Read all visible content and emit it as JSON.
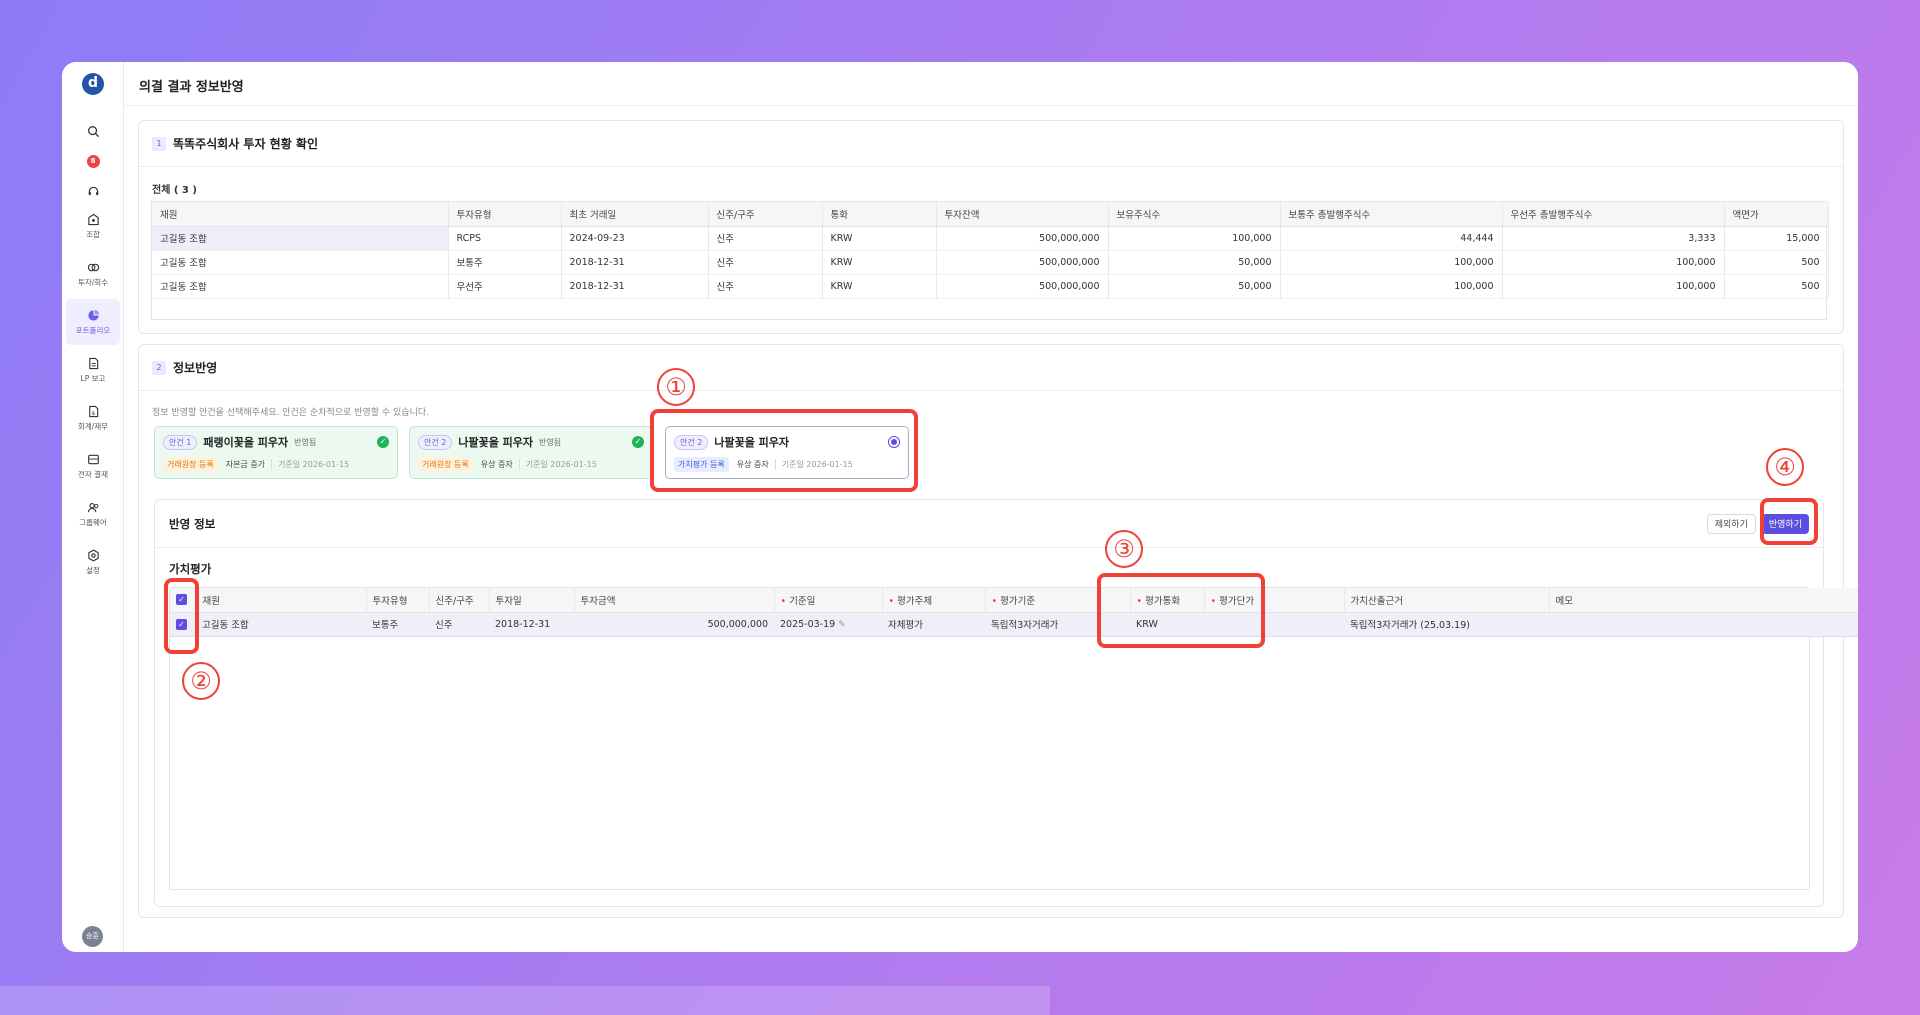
{
  "app": {
    "logo_letter": "d",
    "user_avatar": "승훈"
  },
  "page_title": "의결 결과 정보반영",
  "sidebar": {
    "top_icons": [
      {
        "name": "search-icon"
      },
      {
        "name": "notification-badge",
        "count": "8"
      },
      {
        "name": "headset-icon"
      }
    ],
    "items": [
      {
        "label": "조합",
        "icon": "association-icon",
        "active": false
      },
      {
        "label": "투자/회수",
        "icon": "investment-icon",
        "active": false
      },
      {
        "label": "포트폴리오",
        "icon": "portfolio-icon",
        "active": true
      },
      {
        "label": "LP 보고",
        "icon": "report-icon",
        "active": false
      },
      {
        "label": "회계/재무",
        "icon": "accounting-icon",
        "active": false
      },
      {
        "label": "전자 결재",
        "icon": "approval-icon",
        "active": false
      },
      {
        "label": "그룹웨어",
        "icon": "groupware-icon",
        "active": false
      },
      {
        "label": "설정",
        "icon": "settings-icon",
        "active": false
      }
    ]
  },
  "section1": {
    "number": "1",
    "title": "똑똑주식회사 투자 현황 확인",
    "count_label": "전체 ( 3 )",
    "columns": [
      "재원",
      "투자유형",
      "최초 거래일",
      "신주/구주",
      "통화",
      "투자잔액",
      "보유주식수",
      "보통주 총발행주식수",
      "우선주 총발행주식수",
      "액면가"
    ],
    "rows": [
      [
        "고길동 조합",
        "RCPS",
        "2024-09-23",
        "신주",
        "KRW",
        "500,000,000",
        "100,000",
        "44,444",
        "3,333",
        "15,000"
      ],
      [
        "고길동 조합",
        "보통주",
        "2018-12-31",
        "신주",
        "KRW",
        "500,000,000",
        "50,000",
        "100,000",
        "100,000",
        "500"
      ],
      [
        "고길동 조합",
        "우선주",
        "2018-12-31",
        "신주",
        "KRW",
        "500,000,000",
        "50,000",
        "100,000",
        "100,000",
        "500"
      ]
    ]
  },
  "section2": {
    "number": "2",
    "title": "정보반영",
    "hint": "정보 반영할 안건을 선택해주세요. 안건은 순차적으로 반영할 수 있습니다.",
    "agendas": [
      {
        "chip": "안건 1",
        "title": "패랭이꽃을 피우자",
        "status": "반영됨",
        "tag": "거래원장 등록",
        "sub": "자본금 증가",
        "date": "기준일 2026-01-15"
      },
      {
        "chip": "안건 2",
        "title": "나팔꽃을 피우자",
        "status": "반영됨",
        "tag": "거래원장 등록",
        "sub": "유상 증자",
        "date": "기준일 2026-01-15"
      },
      {
        "chip": "안건 2",
        "title": "나팔꽃을 피우자",
        "status": "",
        "tag": "가치평가 등록",
        "sub": "유상 증자",
        "date": "기준일 2026-01-15"
      }
    ],
    "reflect": {
      "title": "반영 정보",
      "exclude_button": "제외하기",
      "apply_button": "반영하기",
      "valuation_title": "가치평가",
      "columns": [
        "재원",
        "투자유형",
        "신주/구주",
        "투자일",
        "투자금액",
        "기준일",
        "평가주체",
        "평가기준",
        "평가통화",
        "평가단가",
        "가치산출근거",
        "메모"
      ],
      "required": [
        false,
        false,
        false,
        false,
        false,
        true,
        true,
        true,
        true,
        true,
        false,
        false
      ],
      "row": [
        "고길동 조합",
        "보통주",
        "신주",
        "2018-12-31",
        "500,000,000",
        "2025-03-19",
        "자체평가",
        "독립적3자거래가",
        "KRW",
        "",
        "독립적3자거래가 (25.03.19)",
        ""
      ]
    }
  },
  "annotations": [
    "①",
    "②",
    "③",
    "④"
  ],
  "colors": {
    "accent": "#5b4ee0",
    "annotation": "#ef4136",
    "success": "#1fb45a"
  }
}
